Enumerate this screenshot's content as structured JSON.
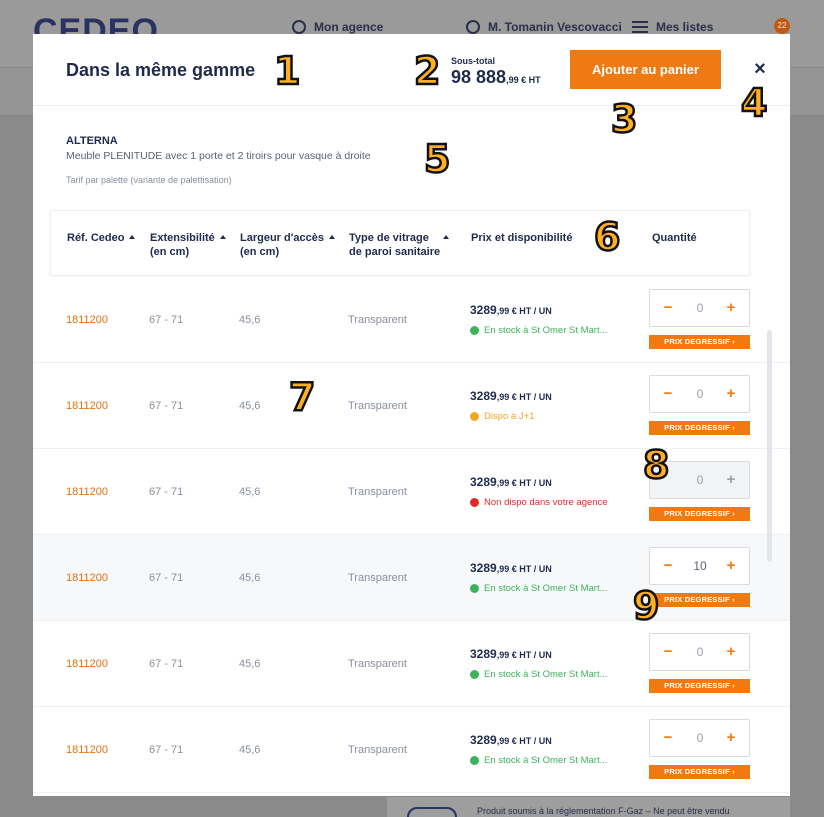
{
  "background": {
    "logo": "CEDEO",
    "nav": [
      {
        "label": "Mon agence",
        "icon": "location-icon"
      },
      {
        "label": "M. Tomanin Vescovacci",
        "icon": "user-icon"
      },
      {
        "label": "Mes listes",
        "icon": "list-icon"
      }
    ],
    "cart_count": "22",
    "footer_note": "Produit soumis à la réglementation F-Gaz – Ne peut être vendu"
  },
  "modal": {
    "title": "Dans la même gamme",
    "subtotal_label": "Sous-total",
    "subtotal_main": "98 888",
    "subtotal_small": ",99 € HT",
    "add_to_cart": "Ajouter au panier",
    "close": "×"
  },
  "product": {
    "brand": "ALTERNA",
    "description": "Meuble PLENITUDE avec 1 porte et 2 tiroirs pour vasque à droite",
    "tarif": "Tarif par palette (variante de palettisation)"
  },
  "table": {
    "headers": {
      "ref": "Réf. Cedeo",
      "ext_1": "Extensibilité",
      "ext_2": "(en cm)",
      "larg_1": "Largeur d'accès",
      "larg_2": "(en cm)",
      "vit_1": "Type de vitrage",
      "vit_2": "de paroi sanitaire",
      "price": "Prix et disponibilité",
      "qty": "Quantité"
    },
    "degressif_label": "PRIX DEGRESSIF ›",
    "rows": [
      {
        "ref": "1811200",
        "ext": "67 - 71",
        "larg": "45,6",
        "vit": "Transparent",
        "price_main": "3289",
        "price_small": ",99 € HT / UN",
        "avail": "En stock à St Omer St Mart...",
        "avail_color": "#3cb35a",
        "qty": "0"
      },
      {
        "ref": "1811200",
        "ext": "67 - 71",
        "larg": "45,6",
        "vit": "Transparent",
        "price_main": "3289",
        "price_small": ",99 € HT / UN",
        "avail": "Dispo à J+1",
        "avail_color": "#f0a820",
        "qty": "0"
      },
      {
        "ref": "1811200",
        "ext": "67 - 71",
        "larg": "45,6",
        "vit": "Transparent",
        "price_main": "3289",
        "price_small": ",99 € HT / UN",
        "avail": "Non dispo dans votre agence",
        "avail_color": "#e02a2a",
        "qty": "0"
      },
      {
        "ref": "1811200",
        "ext": "67 - 71",
        "larg": "45,6",
        "vit": "Transparent",
        "price_main": "3289",
        "price_small": ",99 € HT / UN",
        "avail": "En stock à St Omer St Mart...",
        "avail_color": "#3cb35a",
        "qty": "10"
      },
      {
        "ref": "1811200",
        "ext": "67 - 71",
        "larg": "45,6",
        "vit": "Transparent",
        "price_main": "3289",
        "price_small": ",99 € HT / UN",
        "avail": "En stock à St Omer St Mart...",
        "avail_color": "#3cb35a",
        "qty": "0"
      },
      {
        "ref": "1811200",
        "ext": "67 - 71",
        "larg": "45,6",
        "vit": "Transparent",
        "price_main": "3289",
        "price_small": ",99 € HT / UN",
        "avail": "En stock à St Omer St Mart...",
        "avail_color": "#3cb35a",
        "qty": "0"
      }
    ]
  },
  "annotations": [
    "1",
    "2",
    "3",
    "4",
    "5",
    "6",
    "7",
    "8",
    "9"
  ],
  "colors": {
    "accent": "#f07a12",
    "navy": "#1f2a4d",
    "in_stock": "#3cb35a",
    "next_day": "#f0a820",
    "unavailable": "#e02a2a"
  }
}
